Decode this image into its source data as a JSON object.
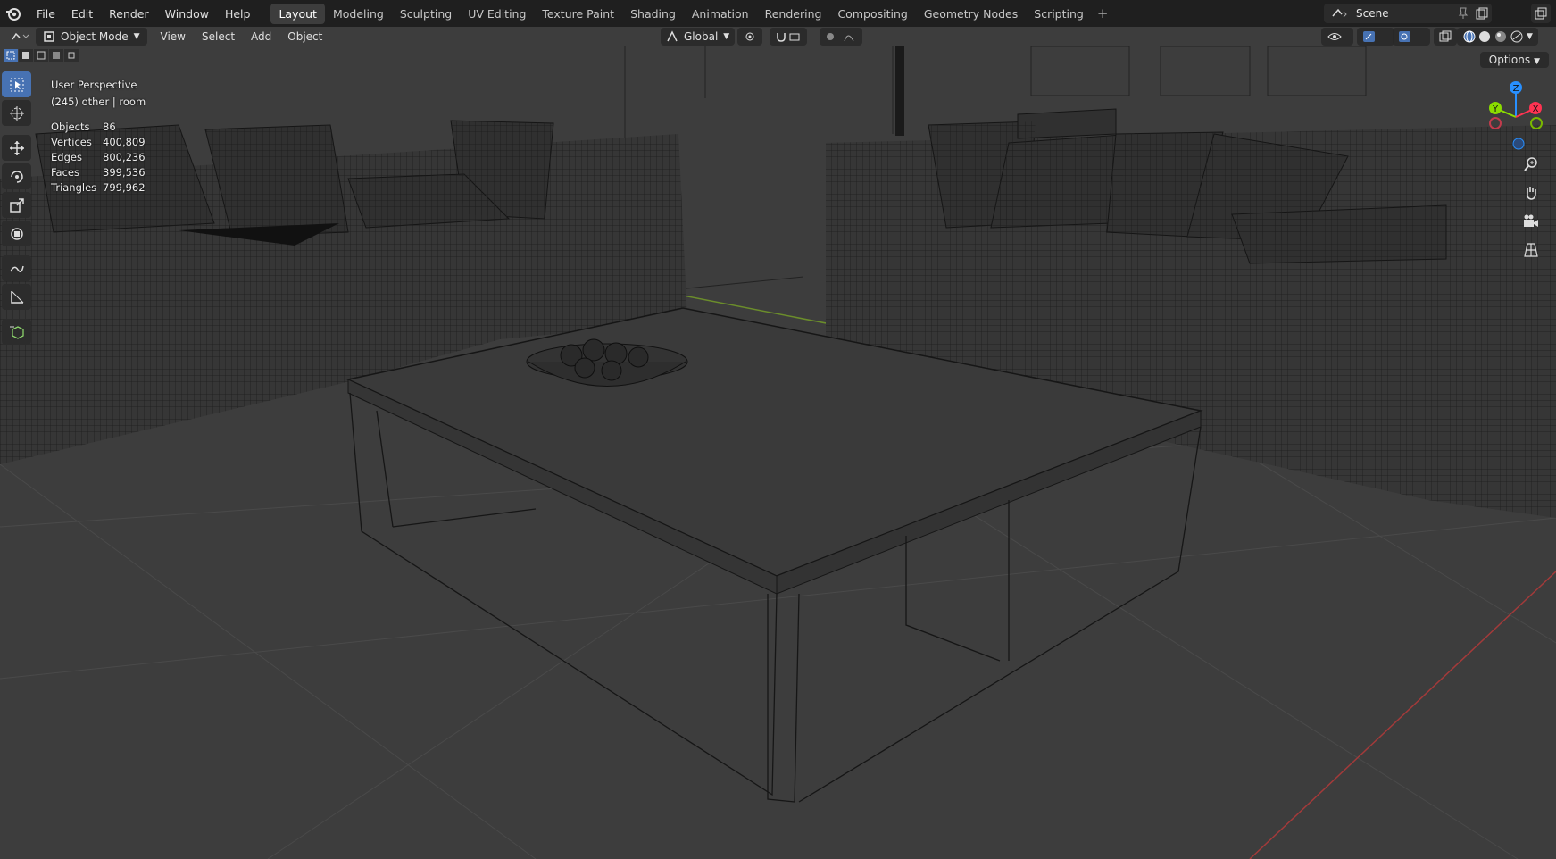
{
  "topbar": {
    "menu": [
      "File",
      "Edit",
      "Render",
      "Window",
      "Help"
    ],
    "workspaces": [
      "Layout",
      "Modeling",
      "Sculpting",
      "UV Editing",
      "Texture Paint",
      "Shading",
      "Animation",
      "Rendering",
      "Compositing",
      "Geometry Nodes",
      "Scripting"
    ],
    "active_workspace": "Layout",
    "add_workspace": "+",
    "scene_name": "Scene"
  },
  "viewport_header": {
    "mode": "Object Mode",
    "menu": [
      "View",
      "Select",
      "Add",
      "Object"
    ],
    "orientation": "Global"
  },
  "viewport": {
    "perspective": "User Perspective",
    "collection": "(245) other | room",
    "options_label": "Options",
    "stats": [
      {
        "label": "Objects",
        "value": "86"
      },
      {
        "label": "Vertices",
        "value": "400,809"
      },
      {
        "label": "Edges",
        "value": "800,236"
      },
      {
        "label": "Faces",
        "value": "399,536"
      },
      {
        "label": "Triangles",
        "value": "799,962"
      }
    ],
    "gizmo": {
      "x": "X",
      "y": "Y",
      "z": "Z"
    }
  },
  "colors": {
    "accent": "#4772b3",
    "viewport_bg": "#3d3d3d",
    "x_axis": "#ff3352",
    "y_axis": "#8bdc00",
    "z_axis": "#2890ff"
  }
}
